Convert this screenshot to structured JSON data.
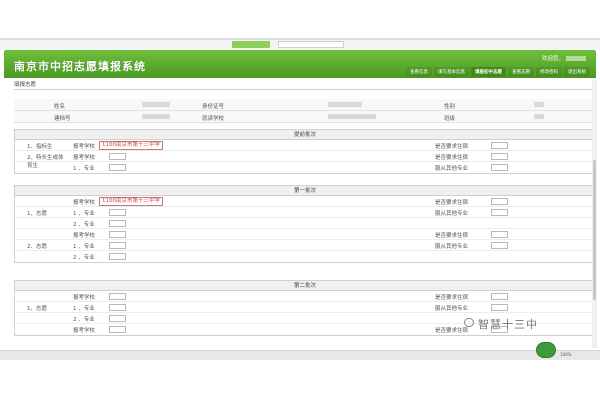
{
  "app": {
    "title": "南京市中招志愿填报系统",
    "welcome": "欢迎您，"
  },
  "nav": {
    "tabs": [
      "查看信息",
      "填写基本信息",
      "填报初中志愿",
      "查看志愿",
      "修改密码",
      "退出系统"
    ],
    "active_index": 2
  },
  "breadcrumb": "填报志愿",
  "student_info": {
    "name_label": "姓名",
    "id_label": "身份证号",
    "gender_label": "性别",
    "file_label": "建档号",
    "school_label": "就读学校",
    "class_label": "班级"
  },
  "sections": {
    "early": {
      "title": "提前批次",
      "cat1": "1、指标生",
      "cat2": "2、特长生或体育生",
      "school_label": "报考学校",
      "major_label": "1 、专业",
      "school_value": "1100南京市第十三中学",
      "dorm_label": "是否要求住宿",
      "obey_label": "服从其他专业"
    },
    "first": {
      "title": "第一批次",
      "cat1": "1、志愿",
      "cat2": "2、志愿",
      "school_label": "报考学校",
      "major1_label": "1 、专业",
      "major2_label": "2 、专业",
      "school_value": "1100南京市第十三中学",
      "dorm_label": "是否要求住宿",
      "obey_label": "服从其他专业"
    },
    "second": {
      "title": "第二批次",
      "cat1": "1、志愿",
      "school_label": "报考学校",
      "major1_label": "1 、专业",
      "major2_label": "2 、专业",
      "dorm_label": "是否要求住宿",
      "obey_label": "服从其他专业"
    }
  },
  "watermark": "智慧十三中",
  "zoom": "100%",
  "colors": {
    "header": "#5aae2e",
    "school_text": "#c24545"
  }
}
